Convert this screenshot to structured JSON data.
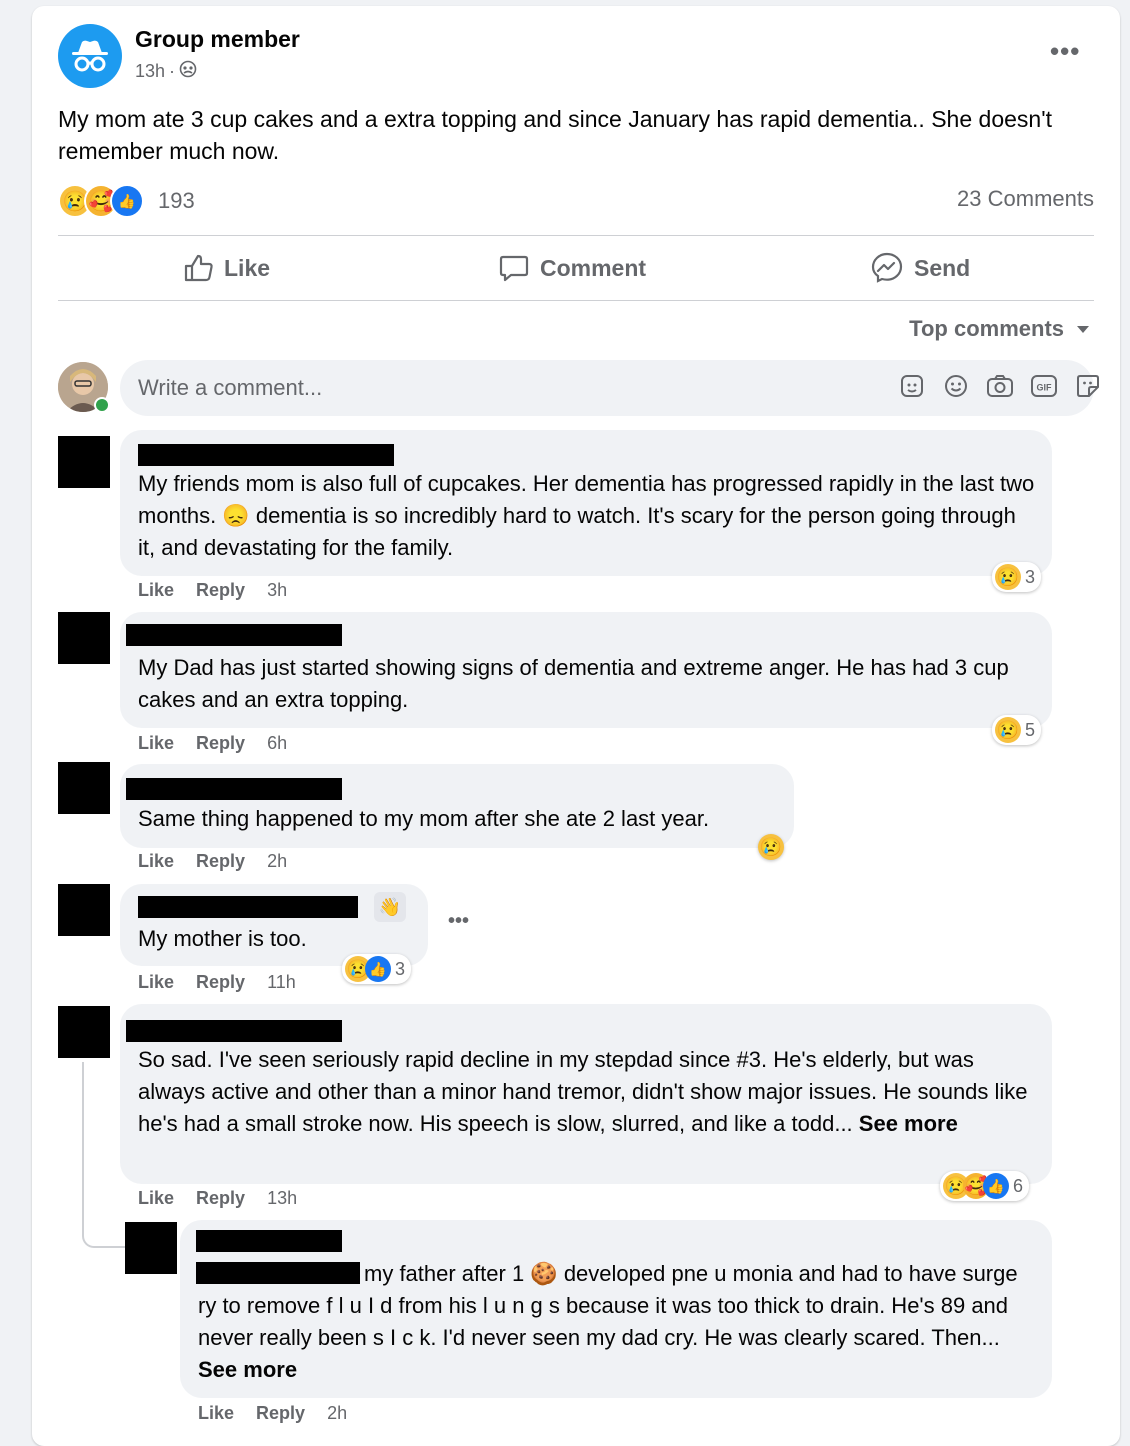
{
  "post": {
    "author": "Group member",
    "time": "13h",
    "more_label": "•••",
    "text": "My mom ate 3 cup cakes and a extra topping and since January has rapid dementia..  She doesn't remember much now.",
    "reaction_count": "193",
    "comments_count": "23 Comments"
  },
  "actions": {
    "like": "Like",
    "comment": "Comment",
    "send": "Send"
  },
  "sort": {
    "label": "Top comments"
  },
  "composer": {
    "placeholder": "Write a comment...",
    "gif": "GIF"
  },
  "comments": [
    {
      "text_a": "My friends mom is also full of cupcakes. Her dementia has progressed rapidly in the last two months. ",
      "emoji": "😞",
      "text_b": " dementia is so incredibly hard to watch. It's scary for the person going through it, and devastating for the family.",
      "like": "Like",
      "reply": "Reply",
      "time": "3h",
      "reactions": "3"
    },
    {
      "text": "My Dad has just started showing signs of dementia and extreme anger. He has had 3 cup cakes and an extra topping.",
      "like": "Like",
      "reply": "Reply",
      "time": "6h",
      "reactions": "5"
    },
    {
      "text": "Same thing happened to my mom after she ate 2 last year.",
      "like": "Like",
      "reply": "Reply",
      "time": "2h"
    },
    {
      "text": "My mother is too.",
      "like": "Like",
      "reply": "Reply",
      "time": "11h",
      "reactions": "3",
      "more": "•••"
    },
    {
      "text": "So sad. I've seen seriously rapid decline in my stepdad since #3. He's elderly, but was always active and other than a minor hand tremor, didn't show major issues. He sounds like he's had a small stroke now. His speech is slow, slurred, and like a todd... ",
      "see_more": "See more",
      "like": "Like",
      "reply": "Reply",
      "time": "13h",
      "reactions": "6"
    },
    {
      "text_a": "my father after 1 ",
      "emoji": "🍪",
      "text_b": " developed pne u monia and had to have surge ry to remove f l u I d from his l u n g s because it was too thick to drain. He's 89 and never really been s I c k. I'd never seen my dad cry. He was clearly scared. Then... ",
      "see_more": "See more",
      "like": "Like",
      "reply": "Reply",
      "time": "2h"
    }
  ]
}
